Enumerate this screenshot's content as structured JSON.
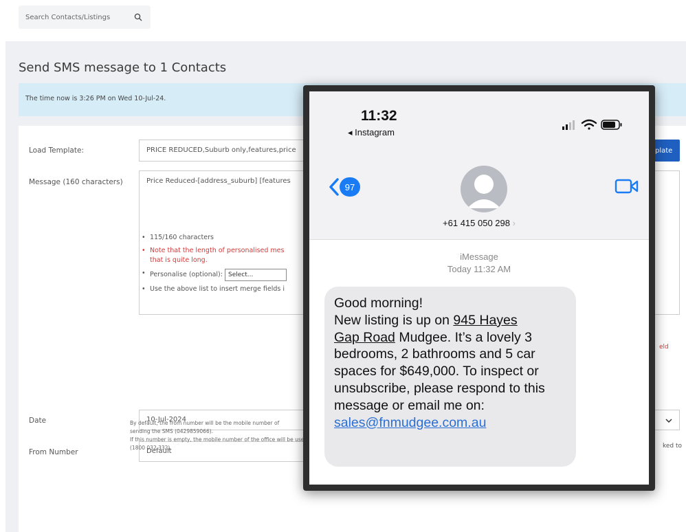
{
  "search": {
    "placeholder": "Search Contacts/Listings"
  },
  "page": {
    "title": "Send SMS message to 1 Contacts",
    "time_banner": "The time now is 3:26 PM on Wed 10-Jul-24."
  },
  "form": {
    "load_template_label": "Load Template:",
    "load_template_value": "PRICE REDUCED,Suburb only,features,price",
    "template_button": "plate",
    "message_label": "Message (160 characters)",
    "message_value": "Price Reduced-[address_suburb] [features",
    "notes": {
      "char_count": "115/160 characters",
      "personalise_warning": "Note that the length of personalised mes",
      "personalise_warning_cont": "that is quite long.",
      "personalise_label": "Personalise (optional):",
      "personalise_select": "Select...",
      "merge_hint": "Use the above list to insert merge fields i"
    },
    "right_warning": "eld",
    "date_label": "Date",
    "date_value": "10-Jul-2024",
    "from_label": "From Number",
    "from_value": "Default",
    "from_right": "ked to",
    "from_note_1": "By default, the from number will be the mobile number of",
    "from_note_2": "sending the SMS (0429859066).",
    "from_note_3": "If this number is empty, the mobile number of the office will be used",
    "from_note_4": "(1800 032 332)."
  },
  "phone": {
    "time": "11:32",
    "back_app": "◂ Instagram",
    "unread_count": "97",
    "contact_number": "+61 415 050 298",
    "service": "iMessage",
    "timestamp": "Today 11:32 AM",
    "message": {
      "line1": "Good morning!",
      "p2a": "New listing is up on ",
      "address_a": "945 Hayes",
      "address_b": "Gap Road",
      "p2b": " Mudgee. It’s a lovely 3 bedrooms, 2 bathrooms and 5 car spaces for $649,000. To inspect or unsubscribe, please respond to this message or email me on:",
      "email": "sales@fnmudgee.com.au"
    }
  },
  "colors": {
    "accent": "#1f5fbf",
    "banner": "#d6ecf7",
    "imessage_blue": "#1a7cf5",
    "bubble": "#e9e9eb",
    "warning": "#d23a3a"
  }
}
